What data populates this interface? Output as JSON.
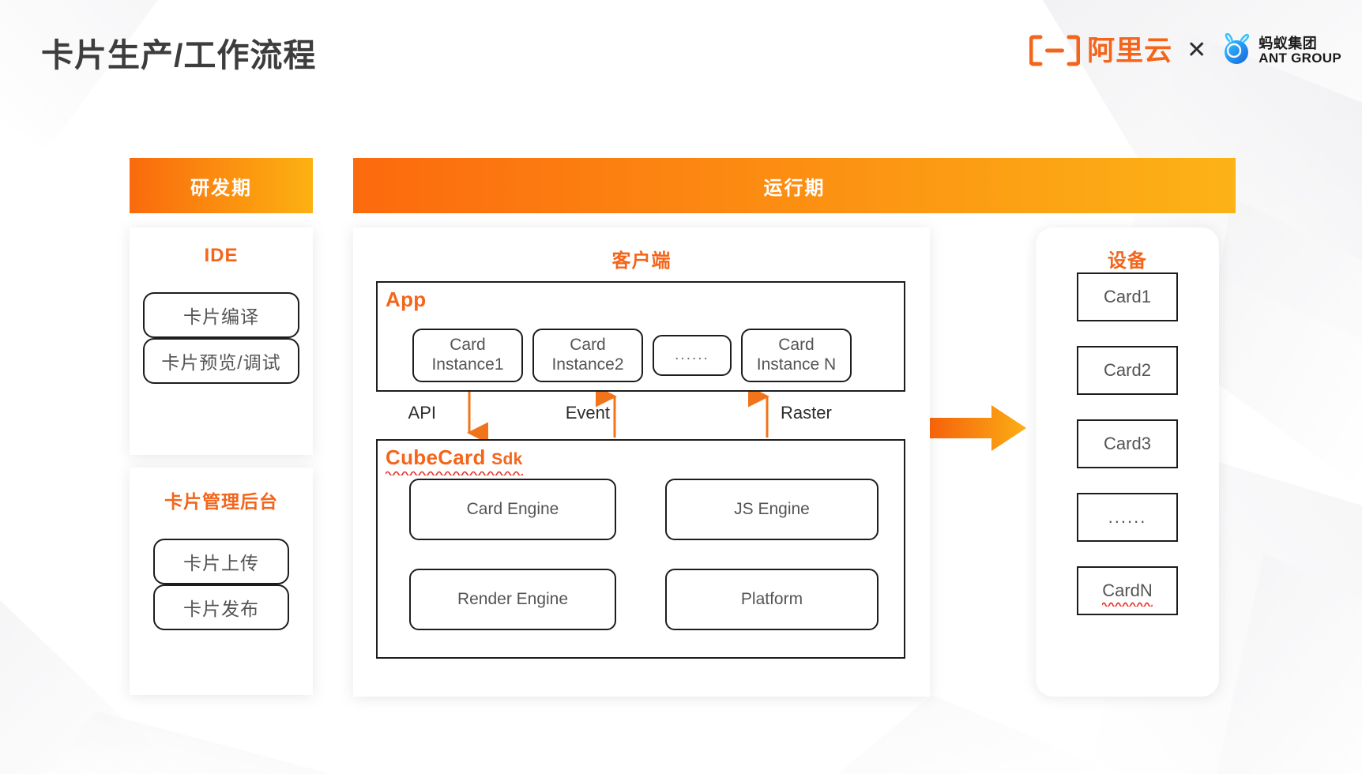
{
  "header": {
    "title": "卡片生产/工作流程",
    "alibaba_cloud_text": "阿里云",
    "separator": "✕",
    "ant_group_cn": "蚂蚁集团",
    "ant_group_en": "ANT GROUP"
  },
  "bands": {
    "dev": "研发期",
    "run": "运行期"
  },
  "ide_panel": {
    "title": "IDE",
    "items": [
      "卡片编译",
      "卡片预览/调试"
    ]
  },
  "admin_panel": {
    "title": "卡片管理后台",
    "items": [
      "卡片上传",
      "卡片发布"
    ]
  },
  "client_panel": {
    "title": "客户端",
    "app": {
      "label": "App",
      "instances": [
        "Card Instance1",
        "Card Instance2",
        "......",
        "Card Instance N"
      ]
    },
    "connectors": [
      {
        "label": "API",
        "direction": "down"
      },
      {
        "label": "Event",
        "direction": "up"
      },
      {
        "label": "Raster",
        "direction": "up"
      }
    ],
    "sdk": {
      "label_main": "CubeCard",
      "label_sub": "Sdk",
      "modules": [
        "Card Engine",
        "JS Engine",
        "Render Engine",
        "Platform"
      ]
    }
  },
  "device_panel": {
    "title": "设备",
    "cards": [
      "Card1",
      "Card2",
      "Card3",
      "......",
      "CardN"
    ]
  },
  "colors": {
    "brand_orange": "#F4651B",
    "band_gradient_start": "#FC6A0E",
    "band_gradient_end": "#FCB316",
    "arrow_orange": "#F2741A",
    "text_dark": "#3d3d3d",
    "box_text": "#545454",
    "spellcheck_red": "#E8352C",
    "ant_blue": "#1677FF"
  }
}
